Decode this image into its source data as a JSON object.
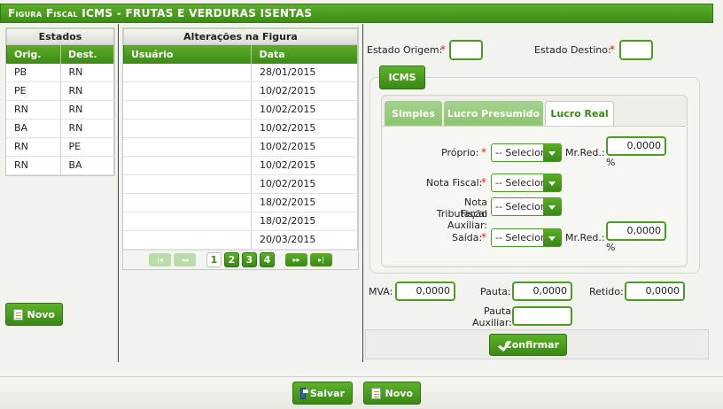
{
  "title": {
    "prefix": "Figura Fiscal ICMS",
    "suffix": " - FRUTAS E VERDURAS ISENTAS"
  },
  "states_panel": {
    "header": "Estados",
    "columns": [
      "Orig.",
      "Dest."
    ],
    "rows": [
      [
        "PB",
        "RN"
      ],
      [
        "PE",
        "RN"
      ],
      [
        "RN",
        "RN"
      ],
      [
        "BA",
        "RN"
      ],
      [
        "RN",
        "PE"
      ],
      [
        "RN",
        "BA"
      ]
    ],
    "new_button": "Novo"
  },
  "changes_panel": {
    "header": "Alterações na Figura",
    "columns": [
      "Usuário",
      "Data"
    ],
    "rows": [
      [
        "",
        "28/01/2015"
      ],
      [
        "",
        "10/02/2015"
      ],
      [
        "",
        "10/02/2015"
      ],
      [
        "",
        "10/02/2015"
      ],
      [
        "",
        "10/02/2015"
      ],
      [
        "",
        "10/02/2015"
      ],
      [
        "",
        "10/02/2015"
      ],
      [
        "",
        "18/02/2015"
      ],
      [
        "",
        "18/02/2015"
      ],
      [
        "",
        "20/03/2015"
      ]
    ],
    "pager": {
      "pages": [
        "1",
        "2",
        "3",
        "4"
      ],
      "current": "1",
      "first": "|◂",
      "prev": "◂◂",
      "next": "▸▸",
      "last": "▸|"
    }
  },
  "form": {
    "estado_origem_label": "Estado Origem:",
    "estado_destino_label": "Estado Destino:",
    "required_mark": "*",
    "icms_button": "ICMS",
    "tabs": [
      "Simples",
      "Lucro Presumido",
      "Lucro Real"
    ],
    "active_tab": "Lucro Real",
    "proprio_label": "Próprio:",
    "nota_fiscal_label": "Nota Fiscal:",
    "nf_trib_aux_label_1": "Nota Fiscal",
    "nf_trib_aux_label_2": "Tributação Auxiliar:",
    "saida_label": "Saída:",
    "select_placeholder": "-- Selecione --",
    "mr_red_label": "Mr.Red.:",
    "percent": "%",
    "proprio_mr_red": "0,0000",
    "saida_mr_red": "0,0000",
    "mva_label": "MVA:",
    "mva_value": "0,0000",
    "pauta_label": "Pauta:",
    "pauta_value": "0,0000",
    "retido_label": "Retido:",
    "retido_value": "0,0000",
    "pauta_aux_label_1": "Pauta",
    "pauta_aux_label_2": "Auxiliar:",
    "pauta_aux_value": "",
    "confirm_button": "Confirmar"
  },
  "footer": {
    "save_button": "Salvar",
    "new_button": "Novo"
  },
  "colors": {
    "accent": "#4b9b25",
    "required": "#d9241a"
  }
}
